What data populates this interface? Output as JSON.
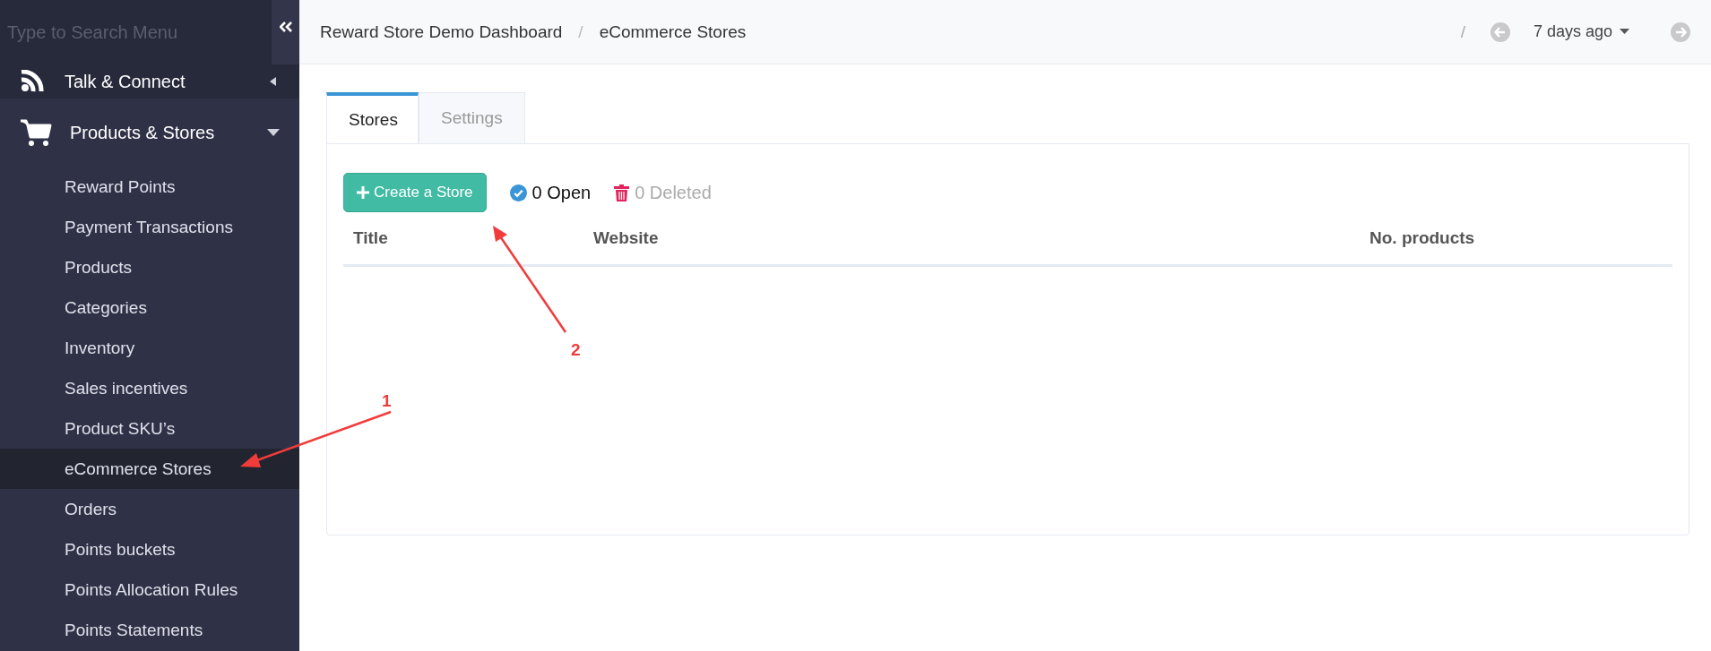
{
  "sidebar": {
    "search": {
      "placeholder": "Type to Search Menu"
    },
    "sections": [
      {
        "label": "Talk & Connect",
        "expanded": false
      },
      {
        "label": "Products & Stores",
        "expanded": true,
        "children": [
          {
            "label": "Reward Points",
            "selected": false
          },
          {
            "label": "Payment Transactions",
            "selected": false
          },
          {
            "label": "Products",
            "selected": false
          },
          {
            "label": "Categories",
            "selected": false
          },
          {
            "label": "Inventory",
            "selected": false
          },
          {
            "label": "Sales incentives",
            "selected": false
          },
          {
            "label": "Product SKU’s",
            "selected": false
          },
          {
            "label": "eCommerce Stores",
            "selected": true
          },
          {
            "label": "Orders",
            "selected": false
          },
          {
            "label": "Points buckets",
            "selected": false
          },
          {
            "label": "Points Allocation Rules",
            "selected": false
          },
          {
            "label": "Points Statements",
            "selected": false
          }
        ]
      }
    ]
  },
  "breadcrumb": {
    "separator": "/",
    "items": [
      "Reward Store Demo Dashboard",
      "eCommerce Stores"
    ]
  },
  "date_nav": {
    "separator": "/",
    "label": "7 days ago"
  },
  "tabs": [
    {
      "label": "Stores",
      "selected": true
    },
    {
      "label": "Settings",
      "selected": false
    }
  ],
  "toolbar": {
    "create_button": "Create a Store",
    "open_count": "0 Open",
    "deleted_count": "0 Deleted"
  },
  "table": {
    "columns": [
      "Title",
      "Website",
      "No. products"
    ]
  },
  "annotations": [
    {
      "label": "1"
    },
    {
      "label": "2"
    }
  ]
}
